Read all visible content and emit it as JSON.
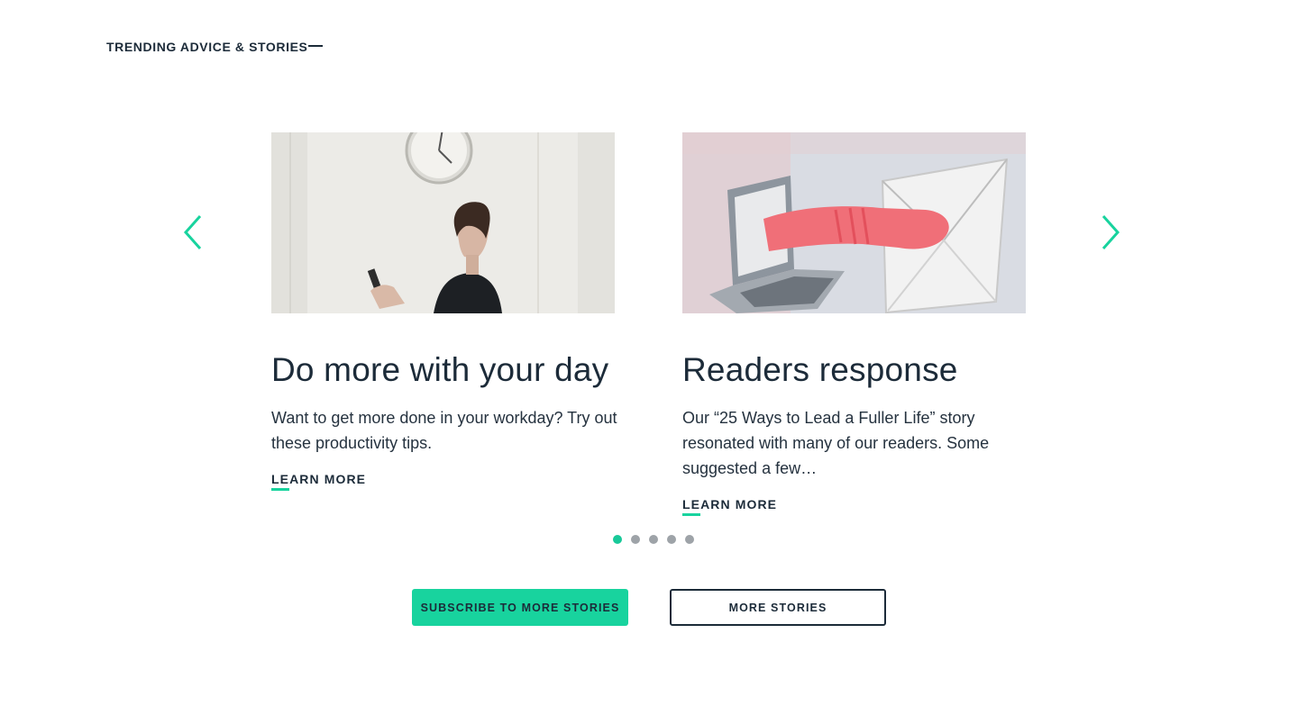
{
  "section": {
    "title": "TRENDING ADVICE & STORIES"
  },
  "carousel": {
    "prev_icon": "chevron-left-icon",
    "next_icon": "chevron-right-icon",
    "cards": [
      {
        "image_icon": "woman-with-phone-photo",
        "title": "Do more with your day",
        "description": "Want to get more done in your workday? Try out these productivity tips.",
        "link": "LEARN MORE"
      },
      {
        "image_icon": "laptop-hand-envelope-illustration",
        "title": "Readers response",
        "description": "Our “25 Ways to Lead a Fuller Life” story resonated with many of our readers. Some suggested a few…",
        "link": "LEARN MORE"
      }
    ],
    "page_count": 5,
    "active_page": 1
  },
  "actions": {
    "subscribe_label": "SUBSCRIBE TO MORE STORIES",
    "more_label": "MORE STORIES"
  },
  "colors": {
    "accent": "#18d39e",
    "text": "#1c2b39",
    "dot_inactive": "#9ea3a8"
  }
}
